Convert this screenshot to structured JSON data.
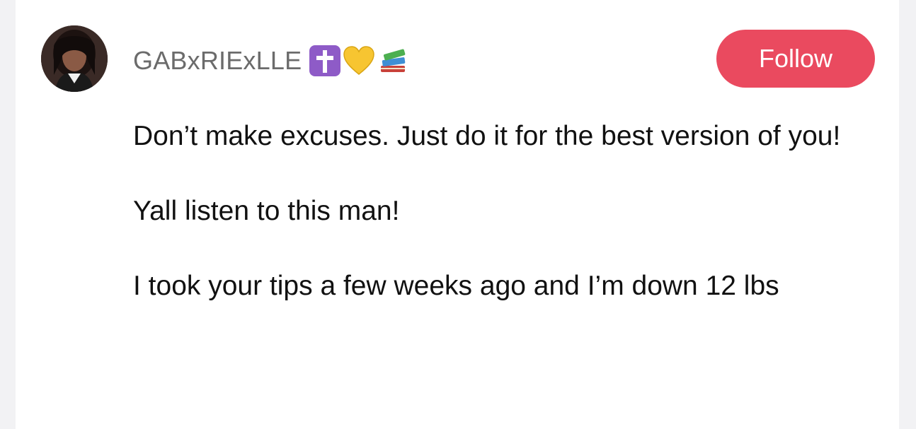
{
  "comment": {
    "username": "GABxRIExLLE",
    "badge_icons": [
      "latin-cross-icon",
      "yellow-heart-icon",
      "books-icon"
    ],
    "follow_label": "Follow",
    "paragraphs": [
      "Don’t make excuses. Just do it for the best version of you!",
      "Yall listen to this man!",
      "I took your tips a few weeks ago and I’m down 12 lbs"
    ]
  },
  "colors": {
    "follow_button": "#ea4a5f",
    "username_text": "#6b6b6b",
    "body_text": "#111111",
    "background": "#ffffff"
  }
}
